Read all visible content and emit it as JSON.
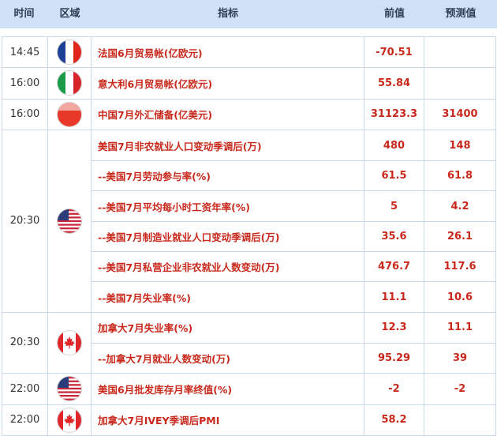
{
  "header": {
    "time": "时间",
    "region": "区域",
    "indicator": "指标",
    "previous": "前值",
    "forecast": "预测值"
  },
  "groups": [
    {
      "time": "14:45",
      "flag": "france-flag-icon",
      "rows": [
        {
          "indicator": "法国6月贸易帐(亿欧元)",
          "previous": "-70.51",
          "forecast": ""
        }
      ]
    },
    {
      "time": "16:00",
      "flag": "italy-flag-icon",
      "rows": [
        {
          "indicator": "意大利6月贸易帐(亿欧元)",
          "previous": "55.84",
          "forecast": ""
        }
      ]
    },
    {
      "time": "16:00",
      "flag": "china-flag-icon",
      "rows": [
        {
          "indicator": "中国7月外汇储备(亿美元)",
          "previous": "31123.3",
          "forecast": "31400"
        }
      ]
    },
    {
      "time": "20:30",
      "flag": "usa-flag-icon",
      "rows": [
        {
          "indicator": "美国7月非农就业人口变动季调后(万)",
          "previous": "480",
          "forecast": "148"
        },
        {
          "indicator": "--美国7月劳动参与率(%)",
          "previous": "61.5",
          "forecast": "61.8"
        },
        {
          "indicator": "--美国7月平均每小时工资年率(%)",
          "previous": "5",
          "forecast": "4.2"
        },
        {
          "indicator": "--美国7月制造业就业人口变动季调后(万)",
          "previous": "35.6",
          "forecast": "26.1"
        },
        {
          "indicator": "--美国7月私营企业非农就业人数变动(万)",
          "previous": "476.7",
          "forecast": "117.6"
        },
        {
          "indicator": "--美国7月失业率(%)",
          "previous": "11.1",
          "forecast": "10.6"
        }
      ]
    },
    {
      "time": "20:30",
      "flag": "canada-flag-icon",
      "rows": [
        {
          "indicator": "加拿大7月失业率(%)",
          "previous": "12.3",
          "forecast": "11.1"
        },
        {
          "indicator": "--加拿大7月就业人数变动(万)",
          "previous": "95.29",
          "forecast": "39"
        }
      ]
    },
    {
      "time": "22:00",
      "flag": "usa-flag-icon",
      "rows": [
        {
          "indicator": "美国6月批发库存月率终值(%)",
          "previous": "-2",
          "forecast": "-2"
        }
      ]
    },
    {
      "time": "22:00",
      "flag": "canada-flag-icon",
      "rows": [
        {
          "indicator": "加拿大7月IVEY季调后PMI",
          "previous": "58.2",
          "forecast": ""
        }
      ]
    }
  ],
  "colors": {
    "header_bg": "#cfe2f5",
    "value_red": "#c8291c",
    "border": "#c9d8ea"
  }
}
